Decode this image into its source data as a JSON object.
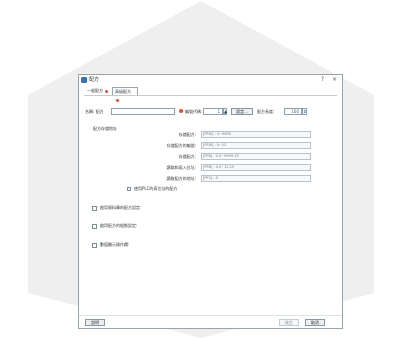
{
  "window": {
    "title": "配方",
    "help_glyph": "?",
    "close_glyph": "×"
  },
  "tabs": [
    {
      "label": "一般配方"
    },
    {
      "label": "高級配方"
    }
  ],
  "top_row": {
    "name_label": "名稱: 配方",
    "name_value": "",
    "count_label": "編號代碼:",
    "count_value": "1",
    "spin_up": "▲",
    "spin_down": "▼",
    "setting_button": "設定...",
    "limit_label": "配方長度:",
    "limit_value": "100",
    "limit_spin": "⇕"
  },
  "address_section": {
    "title": "配方存儲地址",
    "fields": [
      {
        "label": "存儲配方:",
        "value": "[PFW] : 0~9999"
      },
      {
        "label": "存儲配方的編號:",
        "value": "[PFW] : 0~12"
      },
      {
        "label": "存儲配方:",
        "value": "[PFB] : 0.0~9999.15"
      },
      {
        "label": "讀取和寫入位址:",
        "value": "[PFB] : 0.0~12.15"
      },
      {
        "label": "讀取配方的地址:",
        "value": "[PFV] : 0"
      }
    ],
    "note_check_label": "使用PLC的寫位址的配方",
    "note_checked": false
  },
  "options": [
    {
      "label": "啟用資料庫的配方設定:",
      "checked": false
    },
    {
      "label": "啟用配方的組態設定:",
      "checked": false
    },
    {
      "label": "數值顯示操作欄:",
      "checked": false
    }
  ],
  "footer": {
    "help_button": "說明",
    "ok_button": "確定",
    "cancel_button": "取消"
  },
  "colors": {
    "hex_background": "#efefef",
    "accent": "#e0532f",
    "app_icon": "#3a73b8"
  }
}
